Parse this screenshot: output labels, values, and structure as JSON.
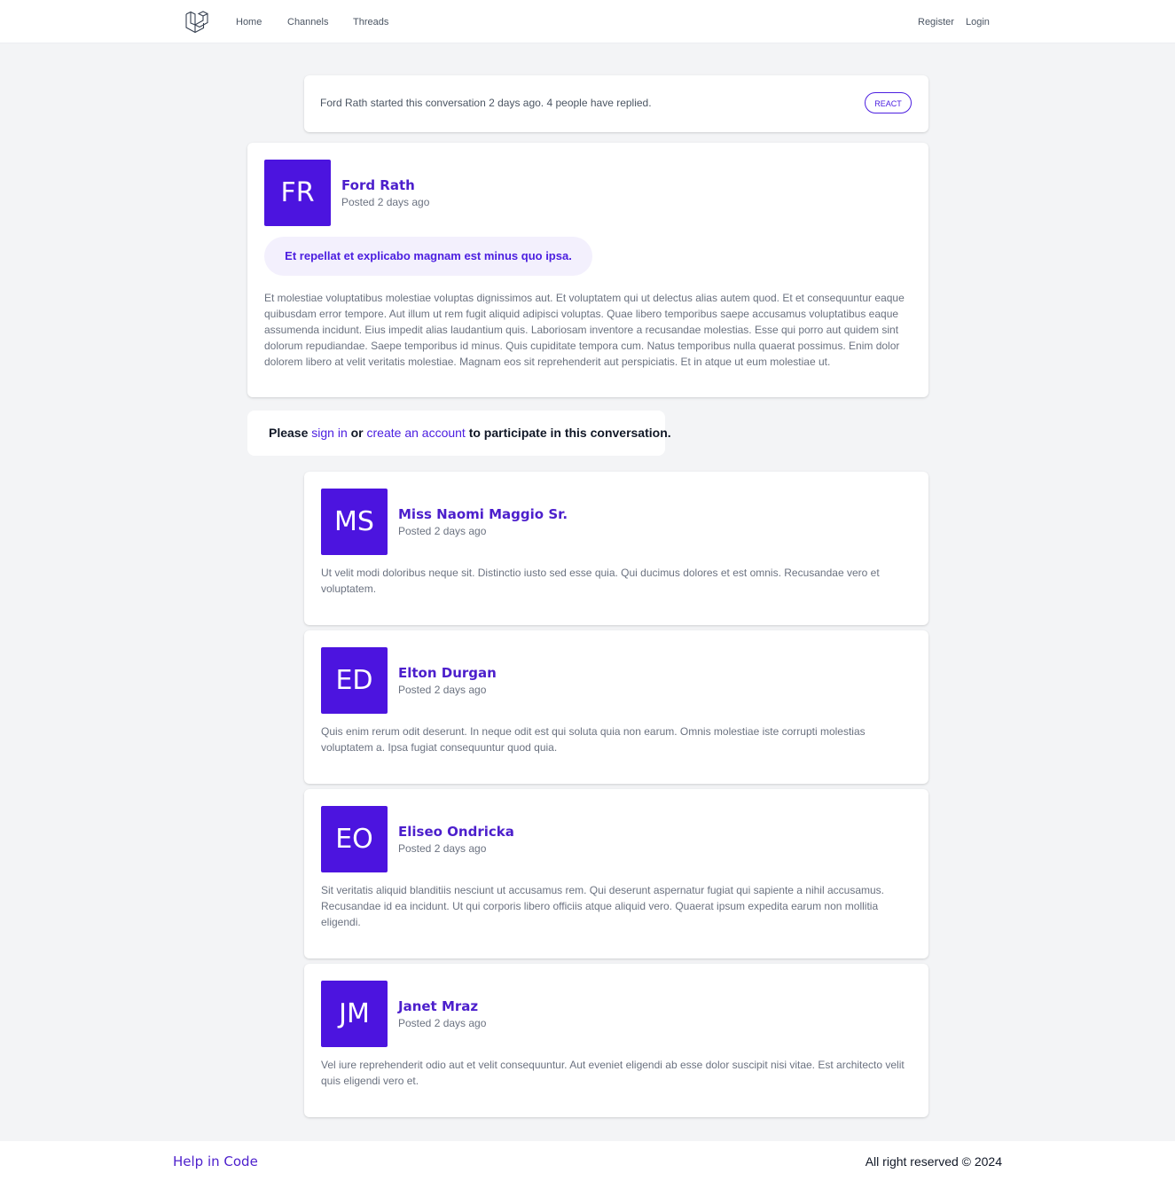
{
  "nav": {
    "links": [
      "Home",
      "Channels",
      "Threads"
    ],
    "register": "Register",
    "login": "Login"
  },
  "summary": {
    "text": "Ford Rath started this conversation 2 days ago. 4 people have replied.",
    "react_label": "REACT"
  },
  "thread": {
    "initials": "FR",
    "author": "Ford Rath",
    "posted": "Posted 2 days ago",
    "title": "Et repellat et explicabo magnam est minus quo ipsa.",
    "body": "Et molestiae voluptatibus molestiae voluptas dignissimos aut. Et voluptatem qui ut delectus alias autem quod. Et et consequuntur eaque quibusdam error tempore. Aut illum ut rem fugit aliquid adipisci voluptas. Quae libero temporibus saepe accusamus voluptatibus eaque assumenda incidunt. Eius impedit alias laudantium quis. Laboriosam inventore a recusandae molestias. Esse qui porro aut quidem sint dolorum repudiandae. Saepe temporibus id minus. Quis cupiditate tempora cum. Natus temporibus nulla quaerat possimus. Enim dolor dolorem libero at velit veritatis molestiae. Magnam eos sit reprehenderit aut perspiciatis. Et in atque ut eum molestiae ut."
  },
  "signin": {
    "prefix": "Please",
    "sign_in": "sign in",
    "or": "or",
    "create_account": "create an account",
    "suffix": "to participate in this conversation."
  },
  "replies": [
    {
      "initials": "MS",
      "author": "Miss Naomi Maggio Sr.",
      "posted": "Posted 2 days ago",
      "body": "Ut velit modi doloribus neque sit. Distinctio iusto sed esse quia. Qui ducimus dolores et est omnis. Recusandae vero et voluptatem."
    },
    {
      "initials": "ED",
      "author": "Elton Durgan",
      "posted": "Posted 2 days ago",
      "body": "Quis enim rerum odit deserunt. In neque odit est qui soluta quia non earum. Omnis molestiae iste corrupti molestias voluptatem a. Ipsa fugiat consequuntur quod quia."
    },
    {
      "initials": "EO",
      "author": "Eliseo Ondricka",
      "posted": "Posted 2 days ago",
      "body": "Sit veritatis aliquid blanditiis nesciunt ut accusamus rem. Qui deserunt aspernatur fugiat qui sapiente a nihil accusamus. Recusandae id ea incidunt. Ut qui corporis libero officiis atque aliquid vero. Quaerat ipsum expedita earum non mollitia eligendi."
    },
    {
      "initials": "JM",
      "author": "Janet Mraz",
      "posted": "Posted 2 days ago",
      "body": "Vel iure reprehenderit odio aut et velit consequuntur. Aut eveniet eligendi ab esse dolor suscipit nisi vitae. Est architecto velit quis eligendi vero et."
    }
  ],
  "footer": {
    "brand": "Help in Code",
    "copyright": "All right reserved © 2024"
  },
  "colors": {
    "accent": "#4c1fe0",
    "avatar": "#4c14df",
    "background": "#f3f4f6"
  }
}
